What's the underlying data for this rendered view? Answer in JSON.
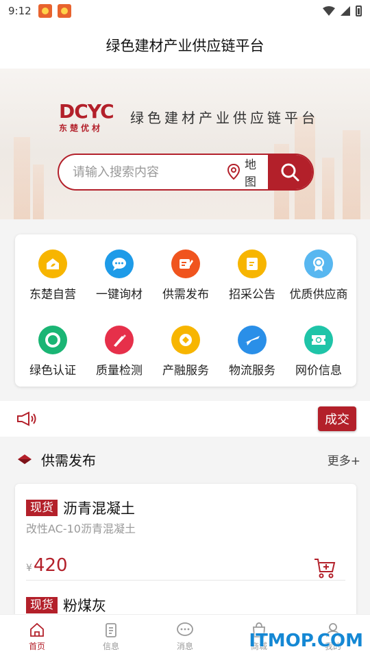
{
  "status_bar": {
    "time": "9:12"
  },
  "header": {
    "title": "绿色建材产业供应链平台"
  },
  "banner": {
    "logo_text": "DCYC",
    "logo_subtext": "东楚优材",
    "title": "绿色建材产业供应链平台",
    "search_placeholder": "请输入搜索内容",
    "map_label": "地图"
  },
  "grid": [
    {
      "label": "东楚自营",
      "icon": "home-leaf-icon",
      "color": "#f7b500"
    },
    {
      "label": "一键询材",
      "icon": "chat-bubble-icon",
      "color": "#1e9be8"
    },
    {
      "label": "供需发布",
      "icon": "edit-note-icon",
      "color": "#f0541e"
    },
    {
      "label": "招采公告",
      "icon": "document-icon",
      "color": "#f7b500"
    },
    {
      "label": "优质供应商",
      "icon": "medal-icon",
      "color": "#58b7f0"
    },
    {
      "label": "绿色认证",
      "icon": "certified-icon",
      "color": "#1ab574"
    },
    {
      "label": "质量检测",
      "icon": "tools-icon",
      "color": "#e6304a"
    },
    {
      "label": "产融服务",
      "icon": "coin-icon",
      "color": "#f7b500"
    },
    {
      "label": "物流服务",
      "icon": "airplane-icon",
      "color": "#2a8fe8"
    },
    {
      "label": "网价信息",
      "icon": "ticket-icon",
      "color": "#1fc4a8"
    }
  ],
  "notice": {
    "badge_label": "成交"
  },
  "section": {
    "title": "供需发布",
    "more_label": "更多+"
  },
  "products": [
    {
      "tag": "现货",
      "name": "沥青混凝土",
      "spec": "改性AC-10沥青混凝土",
      "price_symbol": "¥",
      "price": "420"
    },
    {
      "tag": "现货",
      "name": "粉煤灰"
    }
  ],
  "tabs": [
    {
      "label": "首页",
      "icon": "home-icon",
      "active": true
    },
    {
      "label": "信息",
      "icon": "clipboard-icon"
    },
    {
      "label": "消息",
      "icon": "message-icon"
    },
    {
      "label": "商城",
      "icon": "shopping-bag-icon"
    },
    {
      "label": "我的",
      "icon": "user-icon"
    }
  ],
  "colors": {
    "brand": "#b3202a",
    "background": "#f4f4f4"
  },
  "watermark": "ITMOP.COM"
}
